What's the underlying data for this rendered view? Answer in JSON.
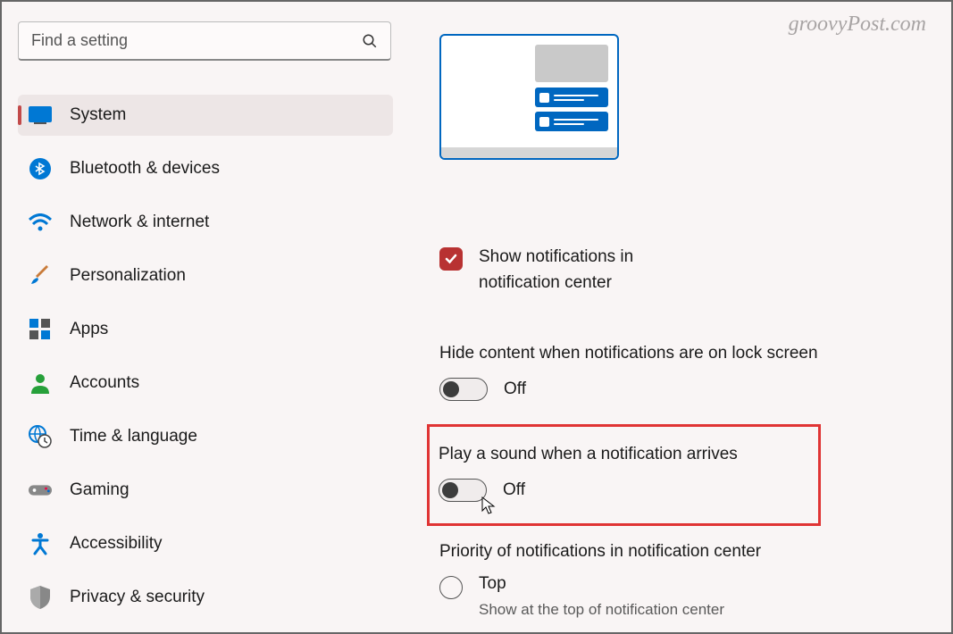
{
  "watermark": "groovyPost.com",
  "search": {
    "placeholder": "Find a setting"
  },
  "sidebar": {
    "items": [
      {
        "id": "system",
        "label": "System",
        "selected": true
      },
      {
        "id": "bluetooth",
        "label": "Bluetooth & devices",
        "selected": false
      },
      {
        "id": "network",
        "label": "Network & internet",
        "selected": false
      },
      {
        "id": "personalization",
        "label": "Personalization",
        "selected": false
      },
      {
        "id": "apps",
        "label": "Apps",
        "selected": false
      },
      {
        "id": "accounts",
        "label": "Accounts",
        "selected": false
      },
      {
        "id": "time",
        "label": "Time & language",
        "selected": false
      },
      {
        "id": "gaming",
        "label": "Gaming",
        "selected": false
      },
      {
        "id": "accessibility",
        "label": "Accessibility",
        "selected": false
      },
      {
        "id": "privacy",
        "label": "Privacy & security",
        "selected": false
      }
    ]
  },
  "main": {
    "show_notifications": {
      "label": "Show notifications in notification center",
      "checked": true
    },
    "hide_content": {
      "title": "Hide content when notifications are on lock screen",
      "state": "Off"
    },
    "play_sound": {
      "title": "Play a sound when a notification arrives",
      "state": "Off"
    },
    "priority": {
      "title": "Priority of notifications in notification center",
      "option_label": "Top",
      "option_desc": "Show at the top of notification center"
    }
  }
}
